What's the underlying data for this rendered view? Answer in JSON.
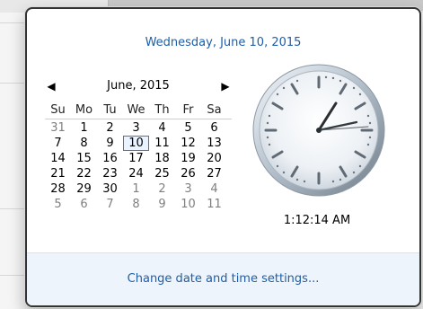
{
  "header": {
    "full_date": "Wednesday, June 10, 2015"
  },
  "calendar": {
    "month_title": "June, 2015",
    "weekdays": [
      "Su",
      "Mo",
      "Tu",
      "We",
      "Th",
      "Fr",
      "Sa"
    ],
    "weeks": [
      [
        "31",
        "1",
        "2",
        "3",
        "4",
        "5",
        "6"
      ],
      [
        "7",
        "8",
        "9",
        "10",
        "11",
        "12",
        "13"
      ],
      [
        "14",
        "15",
        "16",
        "17",
        "18",
        "19",
        "20"
      ],
      [
        "21",
        "22",
        "23",
        "24",
        "25",
        "26",
        "27"
      ],
      [
        "28",
        "29",
        "30",
        "1",
        "2",
        "3",
        "4"
      ],
      [
        "5",
        "6",
        "7",
        "8",
        "9",
        "10",
        "11"
      ]
    ],
    "previous_icon": "chevron-left-icon",
    "next_icon": "chevron-right-icon"
  },
  "clock": {
    "time_text": "1:12:14 AM"
  },
  "footer": {
    "settings_link": "Change date and time settings..."
  }
}
